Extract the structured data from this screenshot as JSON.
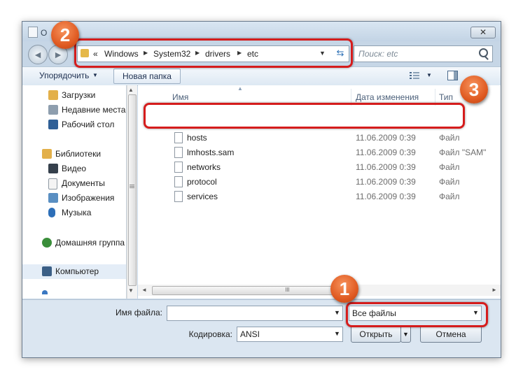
{
  "window": {
    "title": "О",
    "close_label": "✕"
  },
  "address_bar": {
    "prefix": "«",
    "crumbs": [
      "Windows",
      "System32",
      "drivers",
      "etc"
    ],
    "dropdown": "▼",
    "refresh_icon": "refresh-icon"
  },
  "search": {
    "placeholder": "Поиск: etc"
  },
  "toolbar": {
    "organize_label": "Упорядочить",
    "organize_arrow": "▼",
    "new_folder_label": "Новая папка",
    "views_arrow": "▼"
  },
  "nav": {
    "items": [
      {
        "label": "Загрузки",
        "icon": "downloads-icon"
      },
      {
        "label": "Недавние места",
        "icon": "recent-places-icon"
      },
      {
        "label": "Рабочий стол",
        "icon": "desktop-icon"
      },
      {
        "label": "Библиотеки",
        "icon": "libraries-icon"
      },
      {
        "label": "Видео",
        "icon": "video-icon"
      },
      {
        "label": "Документы",
        "icon": "documents-icon"
      },
      {
        "label": "Изображения",
        "icon": "pictures-icon"
      },
      {
        "label": "Музыка",
        "icon": "music-icon"
      },
      {
        "label": "Домашняя группа",
        "icon": "homegroup-icon"
      },
      {
        "label": "Компьютер",
        "icon": "computer-icon"
      }
    ]
  },
  "files": {
    "columns": [
      "Имя",
      "Дата изменения",
      "Тип"
    ],
    "rows": [
      {
        "name": "hosts",
        "date": "11.06.2009 0:39",
        "type": "Файл"
      },
      {
        "name": "lmhosts.sam",
        "date": "11.06.2009 0:39",
        "type": "Файл \"SAM\""
      },
      {
        "name": "networks",
        "date": "11.06.2009 0:39",
        "type": "Файл"
      },
      {
        "name": "protocol",
        "date": "11.06.2009 0:39",
        "type": "Файл"
      },
      {
        "name": "services",
        "date": "11.06.2009 0:39",
        "type": "Файл"
      }
    ]
  },
  "bottom": {
    "filename_label": "Имя файла:",
    "filename_value": "",
    "filetype_value": "Все файлы",
    "encoding_label": "Кодировка:",
    "encoding_value": "ANSI",
    "open_label": "Открыть",
    "cancel_label": "Отмена"
  },
  "annotations": {
    "badge_1": "1",
    "badge_2": "2",
    "badge_3": "3",
    "highlight_color": "#d51c1c",
    "badge_color": "#e05b22"
  },
  "colors": {
    "window_frame": "#c6d6e6",
    "toolbar": "#dde8f3",
    "bottom_panel": "#dbe6f1"
  }
}
